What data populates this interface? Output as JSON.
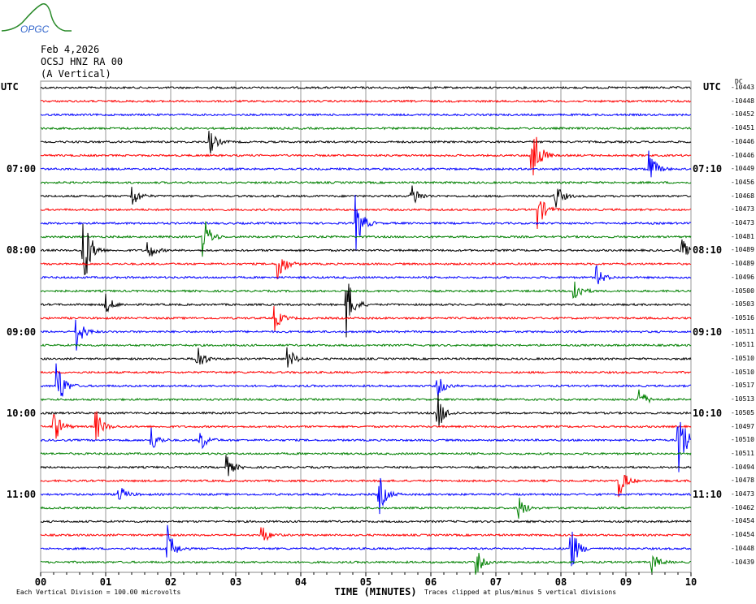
{
  "header": {
    "date": "Feb 4,2026",
    "station": "OCSJ HNZ RA 00",
    "component": "(A Vertical)",
    "logo_text": "OPGC"
  },
  "left_tz": "UTC",
  "right_tz": "UTC",
  "dc_label": "DC",
  "chart_data": {
    "type": "line",
    "title": "Feb 4,2026 OCSJ HNZ RA 00 (A Vertical)",
    "xlabel": "TIME (MINUTES)",
    "x_ticks": [
      "00",
      "01",
      "02",
      "03",
      "04",
      "05",
      "06",
      "07",
      "08",
      "09",
      "10"
    ],
    "xlim": [
      0,
      10
    ],
    "grid": true,
    "left_time_labels": [
      {
        "row": 6,
        "label": "07:00"
      },
      {
        "row": 12,
        "label": "08:00"
      },
      {
        "row": 18,
        "label": "09:00"
      },
      {
        "row": 24,
        "label": "10:00"
      },
      {
        "row": 30,
        "label": "11:00"
      }
    ],
    "right_time_labels": [
      {
        "row": 6,
        "label": "07:10"
      },
      {
        "row": 12,
        "label": "08:10"
      },
      {
        "row": 18,
        "label": "09:10"
      },
      {
        "row": 24,
        "label": "10:10"
      },
      {
        "row": 30,
        "label": "11:10"
      }
    ],
    "trace_colors": [
      "#000000",
      "#ff0000",
      "#0000ff",
      "#008000"
    ],
    "dc_offsets": [
      -10443,
      -10448,
      -10452,
      -10451,
      -10446,
      -10446,
      -10449,
      -10456,
      -10468,
      -10473,
      -10473,
      -10481,
      -10489,
      -10489,
      -10496,
      -10500,
      -10503,
      -10516,
      -10511,
      -10511,
      -10510,
      -10510,
      -10517,
      -10513,
      -10505,
      -10497,
      -10510,
      -10511,
      -10494,
      -10478,
      -10473,
      -10462,
      -10454,
      -10454,
      -10448,
      -10439
    ],
    "events": [
      {
        "row": 5,
        "minute": 7.55,
        "amp": 2.2
      },
      {
        "row": 4,
        "minute": 2.6,
        "amp": 0.6
      },
      {
        "row": 6,
        "minute": 9.35,
        "amp": 1.0
      },
      {
        "row": 8,
        "minute": 1.4,
        "amp": 0.6
      },
      {
        "row": 8,
        "minute": 5.7,
        "amp": 0.7
      },
      {
        "row": 8,
        "minute": 7.9,
        "amp": 0.8
      },
      {
        "row": 9,
        "minute": 7.65,
        "amp": 0.9
      },
      {
        "row": 10,
        "minute": 4.85,
        "amp": 1.3
      },
      {
        "row": 11,
        "minute": 2.5,
        "amp": 1.1
      },
      {
        "row": 12,
        "minute": 0.65,
        "amp": 2.5
      },
      {
        "row": 12,
        "minute": 1.65,
        "amp": 0.5
      },
      {
        "row": 12,
        "minute": 9.85,
        "amp": 0.6
      },
      {
        "row": 13,
        "minute": 3.65,
        "amp": 1.0
      },
      {
        "row": 14,
        "minute": 8.55,
        "amp": 0.5
      },
      {
        "row": 15,
        "minute": 8.2,
        "amp": 0.7
      },
      {
        "row": 16,
        "minute": 4.7,
        "amp": 1.6
      },
      {
        "row": 16,
        "minute": 1.0,
        "amp": 0.5
      },
      {
        "row": 17,
        "minute": 3.6,
        "amp": 0.6
      },
      {
        "row": 18,
        "minute": 0.55,
        "amp": 0.9
      },
      {
        "row": 20,
        "minute": 2.4,
        "amp": 0.8
      },
      {
        "row": 20,
        "minute": 3.8,
        "amp": 0.6
      },
      {
        "row": 22,
        "minute": 0.25,
        "amp": 1.4
      },
      {
        "row": 22,
        "minute": 6.1,
        "amp": 0.6
      },
      {
        "row": 23,
        "minute": 9.2,
        "amp": 0.6
      },
      {
        "row": 24,
        "minute": 6.1,
        "amp": 1.0
      },
      {
        "row": 25,
        "minute": 0.2,
        "amp": 0.9
      },
      {
        "row": 25,
        "minute": 0.85,
        "amp": 0.8
      },
      {
        "row": 26,
        "minute": 9.8,
        "amp": 2.2
      },
      {
        "row": 26,
        "minute": 1.7,
        "amp": 0.6
      },
      {
        "row": 26,
        "minute": 2.45,
        "amp": 0.6
      },
      {
        "row": 28,
        "minute": 2.85,
        "amp": 0.6
      },
      {
        "row": 29,
        "minute": 8.9,
        "amp": 0.8
      },
      {
        "row": 30,
        "minute": 5.2,
        "amp": 1.0
      },
      {
        "row": 30,
        "minute": 1.2,
        "amp": 0.5
      },
      {
        "row": 31,
        "minute": 7.35,
        "amp": 0.6
      },
      {
        "row": 33,
        "minute": 3.4,
        "amp": 0.5
      },
      {
        "row": 34,
        "minute": 1.95,
        "amp": 1.1
      },
      {
        "row": 34,
        "minute": 8.15,
        "amp": 1.3
      },
      {
        "row": 35,
        "minute": 6.7,
        "amp": 0.6
      },
      {
        "row": 35,
        "minute": 9.4,
        "amp": 0.5
      }
    ]
  },
  "footer": {
    "scale_note": "Each Vertical Division =  100.00 microvolts",
    "clip_note": "Traces clipped at plus/minus 5 vertical divisions"
  }
}
